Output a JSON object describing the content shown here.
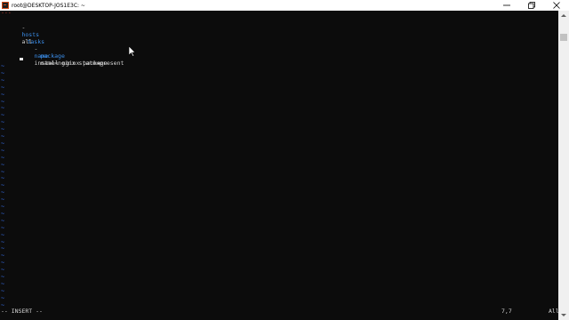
{
  "window": {
    "title": "root@DESKTOP-JOS1E3C: ~",
    "buttons": {
      "minimize": "minimize",
      "maximize": "restore",
      "close": "close"
    }
  },
  "editor": {
    "document_start": "---",
    "lines": [
      {
        "dash": "-",
        "key": "hosts",
        "value": "all"
      },
      {
        "key": "tasks"
      },
      {
        "dash": "-",
        "key": "name",
        "value": "install nginx package"
      },
      {
        "key": "package",
        "value": "name=nginx state=present"
      }
    ],
    "empty_line_marker": "~",
    "empty_line_count": 35,
    "colors": {
      "key": "#3b8eea",
      "text": "#d4d4d4",
      "tilde": "#3b78ff",
      "document_start": "#c0392b",
      "background": "#0c0c0c"
    }
  },
  "status": {
    "mode": "-- INSERT --",
    "position": "7,7",
    "scroll": "All"
  }
}
